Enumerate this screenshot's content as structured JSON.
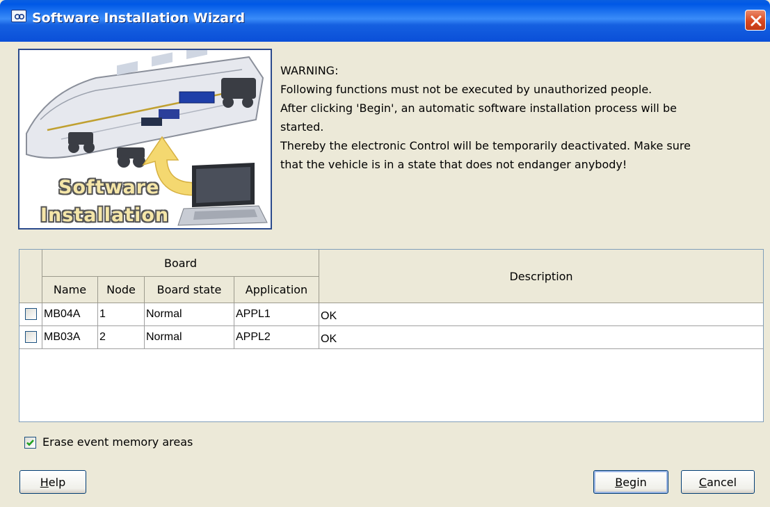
{
  "window": {
    "title": "Software Installation Wizard",
    "icon": "wizard-app-icon",
    "close_icon": "close-icon"
  },
  "banner": {
    "line1": "Software",
    "line2": "Installation"
  },
  "warning": {
    "heading": "WARNING:",
    "line1": "Following functions must not be executed by unauthorized people.",
    "line2": "After clicking 'Begin', an automatic software installation process will be",
    "line3": "started.",
    "line4": "Thereby the electronic Control will be  temporarily deactivated. Make sure",
    "line5": "that the vehicle is in a state that does not endanger anybody!"
  },
  "table": {
    "group_header": "Board",
    "columns": {
      "name": "Name",
      "node": "Node",
      "board_state": "Board state",
      "application": "Application",
      "description": "Description"
    },
    "rows": [
      {
        "checked": false,
        "name": "MB04A",
        "node": "1",
        "board_state": "Normal",
        "application": "APPL1",
        "description": "OK"
      },
      {
        "checked": false,
        "name": "MB03A",
        "node": "2",
        "board_state": "Normal",
        "application": "APPL2",
        "description": "OK"
      }
    ]
  },
  "erase": {
    "checked": true,
    "label": "Erase event memory areas"
  },
  "buttons": {
    "help": {
      "mnemonic": "H",
      "rest": "elp"
    },
    "begin": {
      "mnemonic": "B",
      "rest": "egin"
    },
    "cancel": {
      "mnemonic": "C",
      "rest": "ancel"
    }
  },
  "colors": {
    "titlebar": "#0058e6",
    "dialog_bg": "#ece9d8",
    "close_button": "#d9481f",
    "checkbox_border": "#1c5180",
    "checkmark": "#21a121"
  }
}
